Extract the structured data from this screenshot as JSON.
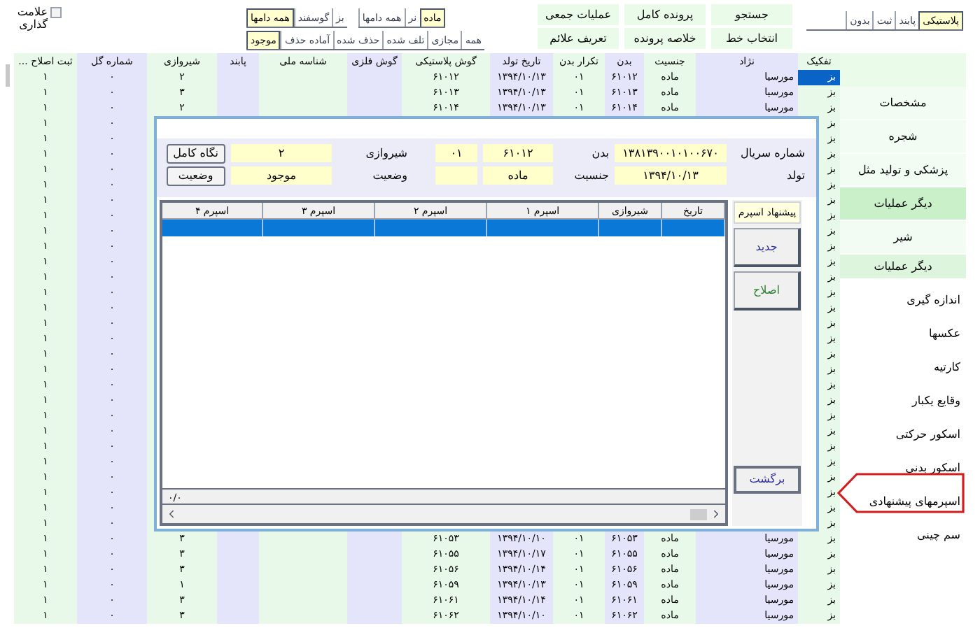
{
  "mark_checkbox": {
    "label": "علامت گذاری",
    "checked": false
  },
  "species_tabs": [
    {
      "label": "بز",
      "selected": false
    },
    {
      "label": "گوسفند",
      "selected": false
    },
    {
      "label": "همه دامها",
      "selected": true
    }
  ],
  "sex_tabs": [
    {
      "label": "ماده",
      "selected": true
    },
    {
      "label": "نر",
      "selected": false
    },
    {
      "label": "همه دامها",
      "selected": false
    }
  ],
  "status_tabs": [
    {
      "label": "همه",
      "selected": false
    },
    {
      "label": "مجازی",
      "selected": false
    },
    {
      "label": "تلف شده",
      "selected": false
    },
    {
      "label": "حذف شده",
      "selected": false
    },
    {
      "label": "آماده حذف",
      "selected": false
    },
    {
      "label": "موجود",
      "selected": true
    }
  ],
  "action_buttons": [
    [
      "جستجو",
      "پرونده کامل",
      "عملیات جمعی"
    ],
    [
      "انتخاب خط",
      "خلاصه پرونده",
      "تعریف علائم"
    ]
  ],
  "tag_tabs": [
    {
      "label": "پلاستیکی",
      "selected": true
    },
    {
      "label": "پابند",
      "selected": false
    },
    {
      "label": "ثبت",
      "selected": false
    },
    {
      "label": "بدون",
      "selected": false
    }
  ],
  "table": {
    "columns": [
      "تفکیک",
      "نژاد",
      "جنسیت",
      "بدن",
      "تکرار بدن",
      "تاریخ تولد",
      "گوش پلاستیکی",
      "گوش فلزی",
      "شناسه ملی",
      "پابند",
      "شیروازی",
      "شماره گل",
      "ثبت اصلاح ..."
    ],
    "rows": [
      {
        "type": "بز",
        "breed": "مورسیا",
        "sex": "ماده",
        "body": "۶۱۰۱۲",
        "body_repeat": "۰۱",
        "birth_date": "۱۳۹۴/۱۰/۱۳",
        "plastic_ear": "۶۱۰۱۲",
        "milk": "۲",
        "flower_no": "۰",
        "fix": "۱",
        "selected": true
      },
      {
        "type": "بز",
        "breed": "مورسیا",
        "sex": "ماده",
        "body": "۶۱۰۱۳",
        "body_repeat": "۰۱",
        "birth_date": "۱۳۹۴/۱۰/۱۳",
        "plastic_ear": "۶۱۰۱۳",
        "milk": "۳",
        "flower_no": "۰",
        "fix": "۱",
        "selected": false
      },
      {
        "type": "بز",
        "breed": "مورسیا",
        "sex": "ماده",
        "body": "۶۱۰۱۴",
        "body_repeat": "۰۱",
        "birth_date": "۱۳۹۴/۱۰/۱۳",
        "plastic_ear": "۶۱۰۱۴",
        "milk": "۲",
        "flower_no": "۰",
        "fix": "۱",
        "selected": false
      },
      {
        "type": "بز",
        "flower_no": "۰",
        "fix": "۱",
        "selected": false
      },
      {
        "type": "بز",
        "flower_no": "۰",
        "fix": "۱",
        "selected": false
      },
      {
        "type": "بز",
        "flower_no": "۰",
        "fix": "۱",
        "selected": false
      },
      {
        "type": "بز",
        "flower_no": "۰",
        "fix": "۱",
        "selected": false
      },
      {
        "type": "بز",
        "flower_no": "۰",
        "fix": "۱",
        "selected": false
      },
      {
        "type": "بز",
        "flower_no": "۰",
        "fix": "۱",
        "selected": false
      },
      {
        "type": "بز",
        "flower_no": "۰",
        "fix": "۱",
        "selected": false
      },
      {
        "type": "بز",
        "flower_no": "۰",
        "fix": "۱",
        "selected": false
      },
      {
        "type": "بز",
        "flower_no": "۰",
        "fix": "۱",
        "selected": false
      },
      {
        "type": "بز",
        "flower_no": "۰",
        "fix": "۱",
        "selected": false
      },
      {
        "type": "بز",
        "flower_no": "۰",
        "fix": "۱",
        "selected": false
      },
      {
        "type": "بز",
        "flower_no": "۰",
        "fix": "۱",
        "selected": false
      },
      {
        "type": "بز",
        "flower_no": "۰",
        "fix": "۱",
        "selected": false
      },
      {
        "type": "بز",
        "flower_no": "۰",
        "fix": "۱",
        "selected": false
      },
      {
        "type": "بز",
        "flower_no": "۰",
        "fix": "۱",
        "selected": false
      },
      {
        "type": "بز",
        "flower_no": "۰",
        "fix": "۱",
        "selected": false
      },
      {
        "type": "بز",
        "flower_no": "۰",
        "fix": "۱",
        "selected": false
      },
      {
        "type": "بز",
        "flower_no": "۰",
        "fix": "۱",
        "selected": false
      },
      {
        "type": "بز",
        "flower_no": "۰",
        "fix": "۱",
        "selected": false
      },
      {
        "type": "بز",
        "flower_no": "۰",
        "fix": "۱",
        "selected": false
      },
      {
        "type": "بز",
        "flower_no": "۰",
        "fix": "۱",
        "selected": false
      },
      {
        "type": "بز",
        "flower_no": "۰",
        "fix": "۱",
        "selected": false
      },
      {
        "type": "بز",
        "flower_no": "۰",
        "fix": "۱",
        "selected": false
      },
      {
        "type": "بز",
        "flower_no": "۰",
        "fix": "۱",
        "selected": false
      },
      {
        "type": "بز",
        "flower_no": "۰",
        "fix": "۱",
        "selected": false
      },
      {
        "type": "بز",
        "flower_no": "۰",
        "fix": "۱",
        "selected": false
      },
      {
        "type": "بز",
        "flower_no": "۰",
        "fix": "۱",
        "selected": false
      },
      {
        "type": "بز",
        "breed": "مورسیا",
        "sex": "ماده",
        "body": "۶۱۰۵۳",
        "body_repeat": "۰۱",
        "birth_date": "۱۳۹۴/۱۰/۱۰",
        "plastic_ear": "۶۱۰۵۳",
        "milk": "۳",
        "flower_no": "۰",
        "fix": "۱",
        "selected": false
      },
      {
        "type": "بز",
        "breed": "مورسیا",
        "sex": "ماده",
        "body": "۶۱۰۵۵",
        "body_repeat": "۰۱",
        "birth_date": "۱۳۹۴/۱۰/۱۷",
        "plastic_ear": "۶۱۰۵۵",
        "milk": "۳",
        "flower_no": "۰",
        "fix": "۱",
        "selected": false
      },
      {
        "type": "بز",
        "breed": "مورسیا",
        "sex": "ماده",
        "body": "۶۱۰۵۶",
        "body_repeat": "۰۱",
        "birth_date": "۱۳۹۴/۱۰/۱۴",
        "plastic_ear": "۶۱۰۵۶",
        "milk": "۳",
        "flower_no": "۰",
        "fix": "۱",
        "selected": false
      },
      {
        "type": "بز",
        "breed": "مورسیا",
        "sex": "ماده",
        "body": "۶۱۰۵۹",
        "body_repeat": "۰۱",
        "birth_date": "۱۳۹۴/۱۰/۱۳",
        "plastic_ear": "۶۱۰۵۹",
        "milk": "۱",
        "flower_no": "۰",
        "fix": "۱",
        "selected": false
      },
      {
        "type": "بز",
        "breed": "مورسیا",
        "sex": "ماده",
        "body": "۶۱۰۶۱",
        "body_repeat": "۰۱",
        "birth_date": "۱۳۹۴/۱۰/۱۴",
        "plastic_ear": "۶۱۰۶۱",
        "milk": "۳",
        "flower_no": "۰",
        "fix": "۱",
        "selected": false
      },
      {
        "type": "بز",
        "breed": "مورسیا",
        "sex": "ماده",
        "body": "۶۱۰۶۲",
        "body_repeat": "۰۱",
        "birth_date": "۱۳۹۴/۱۰/۱۰",
        "plastic_ear": "۶۱۰۶۲",
        "milk": "۳",
        "flower_no": "۰",
        "fix": "۱",
        "selected": false
      }
    ]
  },
  "sidebar": [
    {
      "label": "مشخصات",
      "kind": "section"
    },
    {
      "label": "شجره",
      "kind": "section"
    },
    {
      "label": "پزشکی و تولید مثل",
      "kind": "section"
    },
    {
      "label": "دیگر عملیات",
      "kind": "header"
    },
    {
      "label": "شیر",
      "kind": "section"
    },
    {
      "label": "دیگر عملیات",
      "kind": "subheader"
    },
    {
      "label": "اندازه گیری",
      "kind": "link",
      "highlighted": false
    },
    {
      "label": "عکسها",
      "kind": "link",
      "highlighted": false
    },
    {
      "label": "کارتیه",
      "kind": "link",
      "highlighted": false
    },
    {
      "label": "وقایع یکبار",
      "kind": "link",
      "highlighted": false
    },
    {
      "label": "اسکور حرکتی",
      "kind": "link",
      "highlighted": false
    },
    {
      "label": "اسکور بدنی",
      "kind": "link",
      "highlighted": false
    },
    {
      "label": "اسپرمهای پیشنهادی",
      "kind": "link",
      "highlighted": true
    },
    {
      "label": "سم چینی",
      "kind": "link",
      "highlighted": false
    }
  ],
  "dialog": {
    "serial_label": "شماره سریال",
    "serial": "۱۳۸۱۳۹۰۰۱۰۱۰۰۶۷۰",
    "birth_label": "تولد",
    "birth": "۱۳۹۴/۱۰/۱۳",
    "body_label": "بدن",
    "body": "۶۱۰۱۲",
    "repeat": "۰۱",
    "sex_label": "جنسیت",
    "sex": "ماده",
    "milk_label": "شیروازی",
    "milk": "۲",
    "status_label": "وضعیت",
    "status": "موجود",
    "buttons": [
      "نگاه کامل",
      "وضعیت"
    ],
    "grid": {
      "columns": [
        "تاریخ",
        "شیروازی",
        "اسپرم ۱",
        "اسپرم ۲",
        "اسپرم ۳",
        "اسپرم ۴"
      ],
      "rows": [
        {
          "selected": true
        }
      ],
      "counter": "۰/۰"
    },
    "side_title": "پیشنهاد اسپرم",
    "side_buttons": [
      {
        "label": "جدید",
        "kind": "new"
      },
      {
        "label": "اصلاح",
        "kind": "edit"
      }
    ],
    "back_button": "برگشت"
  }
}
